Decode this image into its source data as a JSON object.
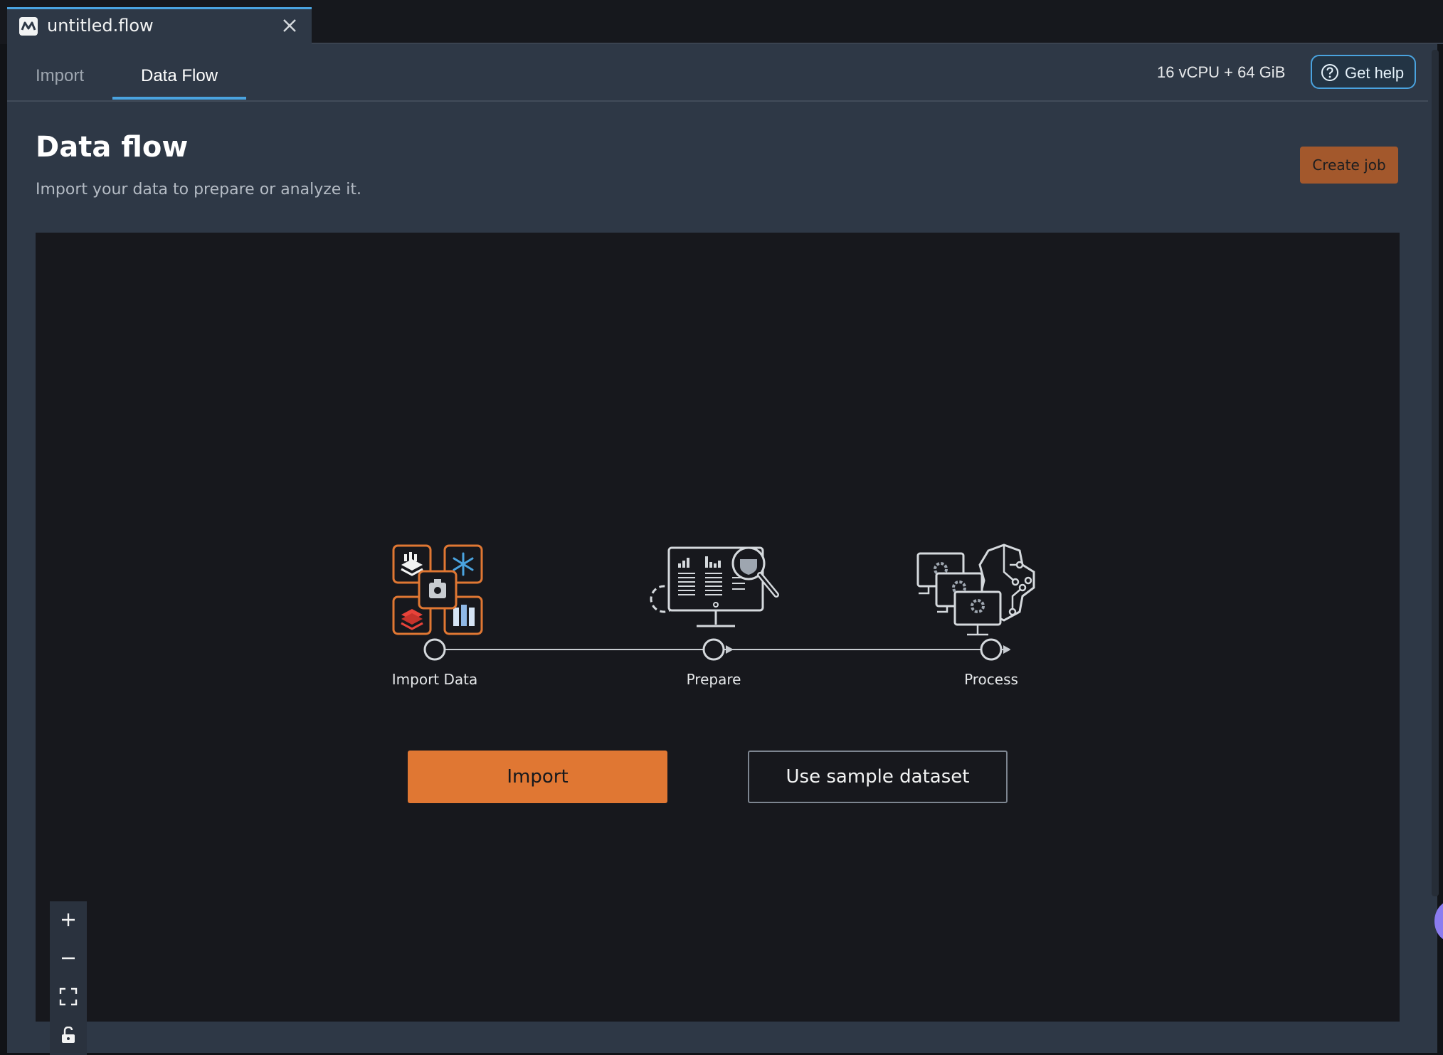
{
  "file_tab": {
    "name": "untitled.flow"
  },
  "nav": {
    "tabs": [
      {
        "label": "Import"
      },
      {
        "label": "Data Flow"
      }
    ],
    "resources": "16 vCPU + 64 GiB",
    "help_label": "Get help"
  },
  "header": {
    "title": "Data flow",
    "subtitle": "Import your data to prepare or analyze it.",
    "create_job_label": "Create job"
  },
  "steps": [
    {
      "label": "Import Data"
    },
    {
      "label": "Prepare"
    },
    {
      "label": "Process"
    }
  ],
  "actions": {
    "import_label": "Import",
    "sample_label": "Use sample dataset"
  },
  "colors": {
    "accent": "#e07733",
    "link": "#4aa3df",
    "panel": "#2e3846",
    "canvas": "#17181d"
  },
  "icons": {
    "file_tab": "data-wrangler-logo-icon",
    "close": "close-icon",
    "help": "question-circle-icon",
    "zoom_in": "plus-icon",
    "zoom_out": "minus-icon",
    "fit": "fit-view-icon",
    "lock": "unlock-icon"
  }
}
